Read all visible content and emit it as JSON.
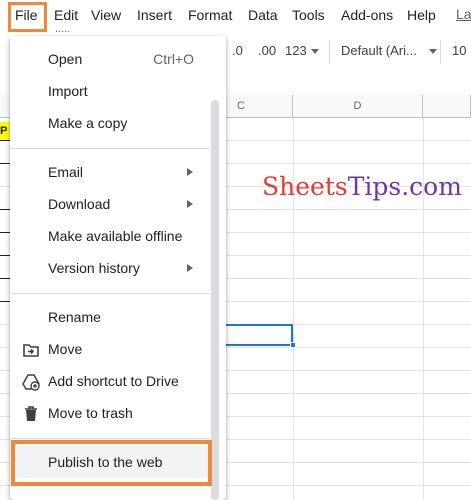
{
  "menubar": {
    "items": [
      "File",
      "Edit",
      "View",
      "Insert",
      "Format",
      "Data",
      "Tools",
      "Add-ons",
      "Help"
    ],
    "last_edit": "La",
    "cut_off_text": "....."
  },
  "toolbar": {
    "decrease_decimal": ".0",
    "increase_decimal": ".00",
    "number_format": "123",
    "font": "Default (Ari...",
    "font_size": "10"
  },
  "grid": {
    "columns": [
      "C",
      "D"
    ],
    "cell_fragment": "P"
  },
  "watermark": {
    "part1": "Sheets",
    "part2": "Tips.com"
  },
  "file_menu": {
    "open": {
      "label": "Open",
      "shortcut": "Ctrl+O"
    },
    "import": "Import",
    "make_copy": "Make a copy",
    "email": "Email",
    "download": "Download",
    "offline": "Make available offline",
    "version_history": "Version history",
    "rename": "Rename",
    "move": "Move",
    "add_shortcut": "Add shortcut to Drive",
    "move_trash": "Move to trash",
    "publish": "Publish to the web"
  },
  "colors": {
    "highlight": "#f0883c",
    "selection": "#1a73e8"
  }
}
